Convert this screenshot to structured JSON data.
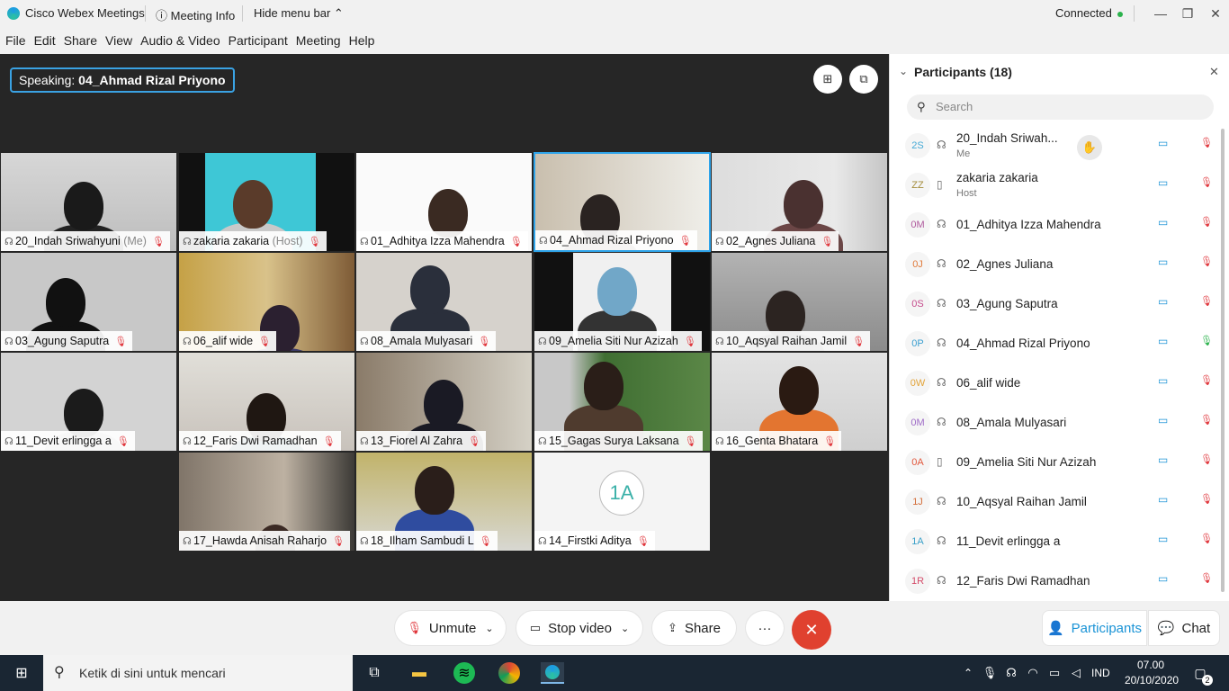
{
  "titlebar": {
    "app_name": "Cisco Webex Meetings",
    "meeting_info": "Meeting Info",
    "hide_menu": "Hide menu bar",
    "status": "Connected",
    "colors": {
      "connected": "#2bb24c"
    }
  },
  "menu": [
    "File",
    "Edit",
    "Share",
    "View",
    "Audio & Video",
    "Participant",
    "Meeting",
    "Help"
  ],
  "stage": {
    "speaking_prefix": "Speaking:",
    "speaking_name": "04_Ahmad Rizal Priyono",
    "tiles": [
      {
        "name": "20_Indah Sriwahyuni",
        "suffix": "(Me)"
      },
      {
        "name": "zakaria zakaria",
        "suffix": "(Host)"
      },
      {
        "name": "01_Adhitya Izza Mahendra",
        "suffix": ""
      },
      {
        "name": "04_Ahmad Rizal Priyono",
        "suffix": ""
      },
      {
        "name": "02_Agnes Juliana",
        "suffix": ""
      },
      {
        "name": "03_Agung Saputra",
        "suffix": ""
      },
      {
        "name": "06_alif wide",
        "suffix": ""
      },
      {
        "name": "08_Amala Mulyasari",
        "suffix": ""
      },
      {
        "name": "09_Amelia Siti Nur Azizah",
        "suffix": ""
      },
      {
        "name": "10_Aqsyal Raihan Jamil",
        "suffix": ""
      },
      {
        "name": "11_Devit erlingga a",
        "suffix": ""
      },
      {
        "name": "12_Faris Dwi Ramadhan",
        "suffix": ""
      },
      {
        "name": "13_Fiorel Al Zahra",
        "suffix": ""
      },
      {
        "name": "15_Gagas Surya Laksana",
        "suffix": ""
      },
      {
        "name": "16_Genta Bhatara",
        "suffix": ""
      },
      {
        "name": "17_Hawda Anisah Raharjo",
        "suffix": ""
      },
      {
        "name": "18_Ilham Sambudi L",
        "suffix": ""
      },
      {
        "name": "14_Firstki Aditya",
        "suffix": ""
      }
    ],
    "avatar_initials": "1A"
  },
  "panel": {
    "title": "Participants (18)",
    "search_placeholder": "Search",
    "participants": [
      {
        "initials": "2S",
        "name": "20_Indah Sriwah...",
        "role": "Me",
        "mic_on": false
      },
      {
        "initials": "ZZ",
        "name": "zakaria zakaria",
        "role": "Host",
        "mic_on": false
      },
      {
        "initials": "0M",
        "name": "01_Adhitya Izza Mahendra",
        "role": "",
        "mic_on": false
      },
      {
        "initials": "0J",
        "name": "02_Agnes Juliana",
        "role": "",
        "mic_on": false
      },
      {
        "initials": "0S",
        "name": "03_Agung Saputra",
        "role": "",
        "mic_on": false
      },
      {
        "initials": "0P",
        "name": "04_Ahmad Rizal Priyono",
        "role": "",
        "mic_on": true
      },
      {
        "initials": "0W",
        "name": "06_alif wide",
        "role": "",
        "mic_on": false
      },
      {
        "initials": "0M",
        "name": "08_Amala Mulyasari",
        "role": "",
        "mic_on": false
      },
      {
        "initials": "0A",
        "name": "09_Amelia Siti Nur Azizah",
        "role": "",
        "mic_on": false
      },
      {
        "initials": "1J",
        "name": "10_Aqsyal Raihan Jamil",
        "role": "",
        "mic_on": false
      },
      {
        "initials": "1A",
        "name": "11_Devit erlingga a",
        "role": "",
        "mic_on": false
      },
      {
        "initials": "1R",
        "name": "12_Faris Dwi Ramadhan",
        "role": "",
        "mic_on": false
      }
    ]
  },
  "controls": {
    "unmute": "Unmute",
    "stop_video": "Stop video",
    "share": "Share",
    "more": "···",
    "participants": "Participants",
    "chat": "Chat",
    "colors": {
      "end": "#e0412f",
      "accent": "#1a93d6"
    }
  },
  "taskbar": {
    "search_placeholder": "Ketik di sini untuk mencari",
    "lang": "IND",
    "time": "07.00",
    "date": "20/10/2020",
    "notifications": "2"
  }
}
